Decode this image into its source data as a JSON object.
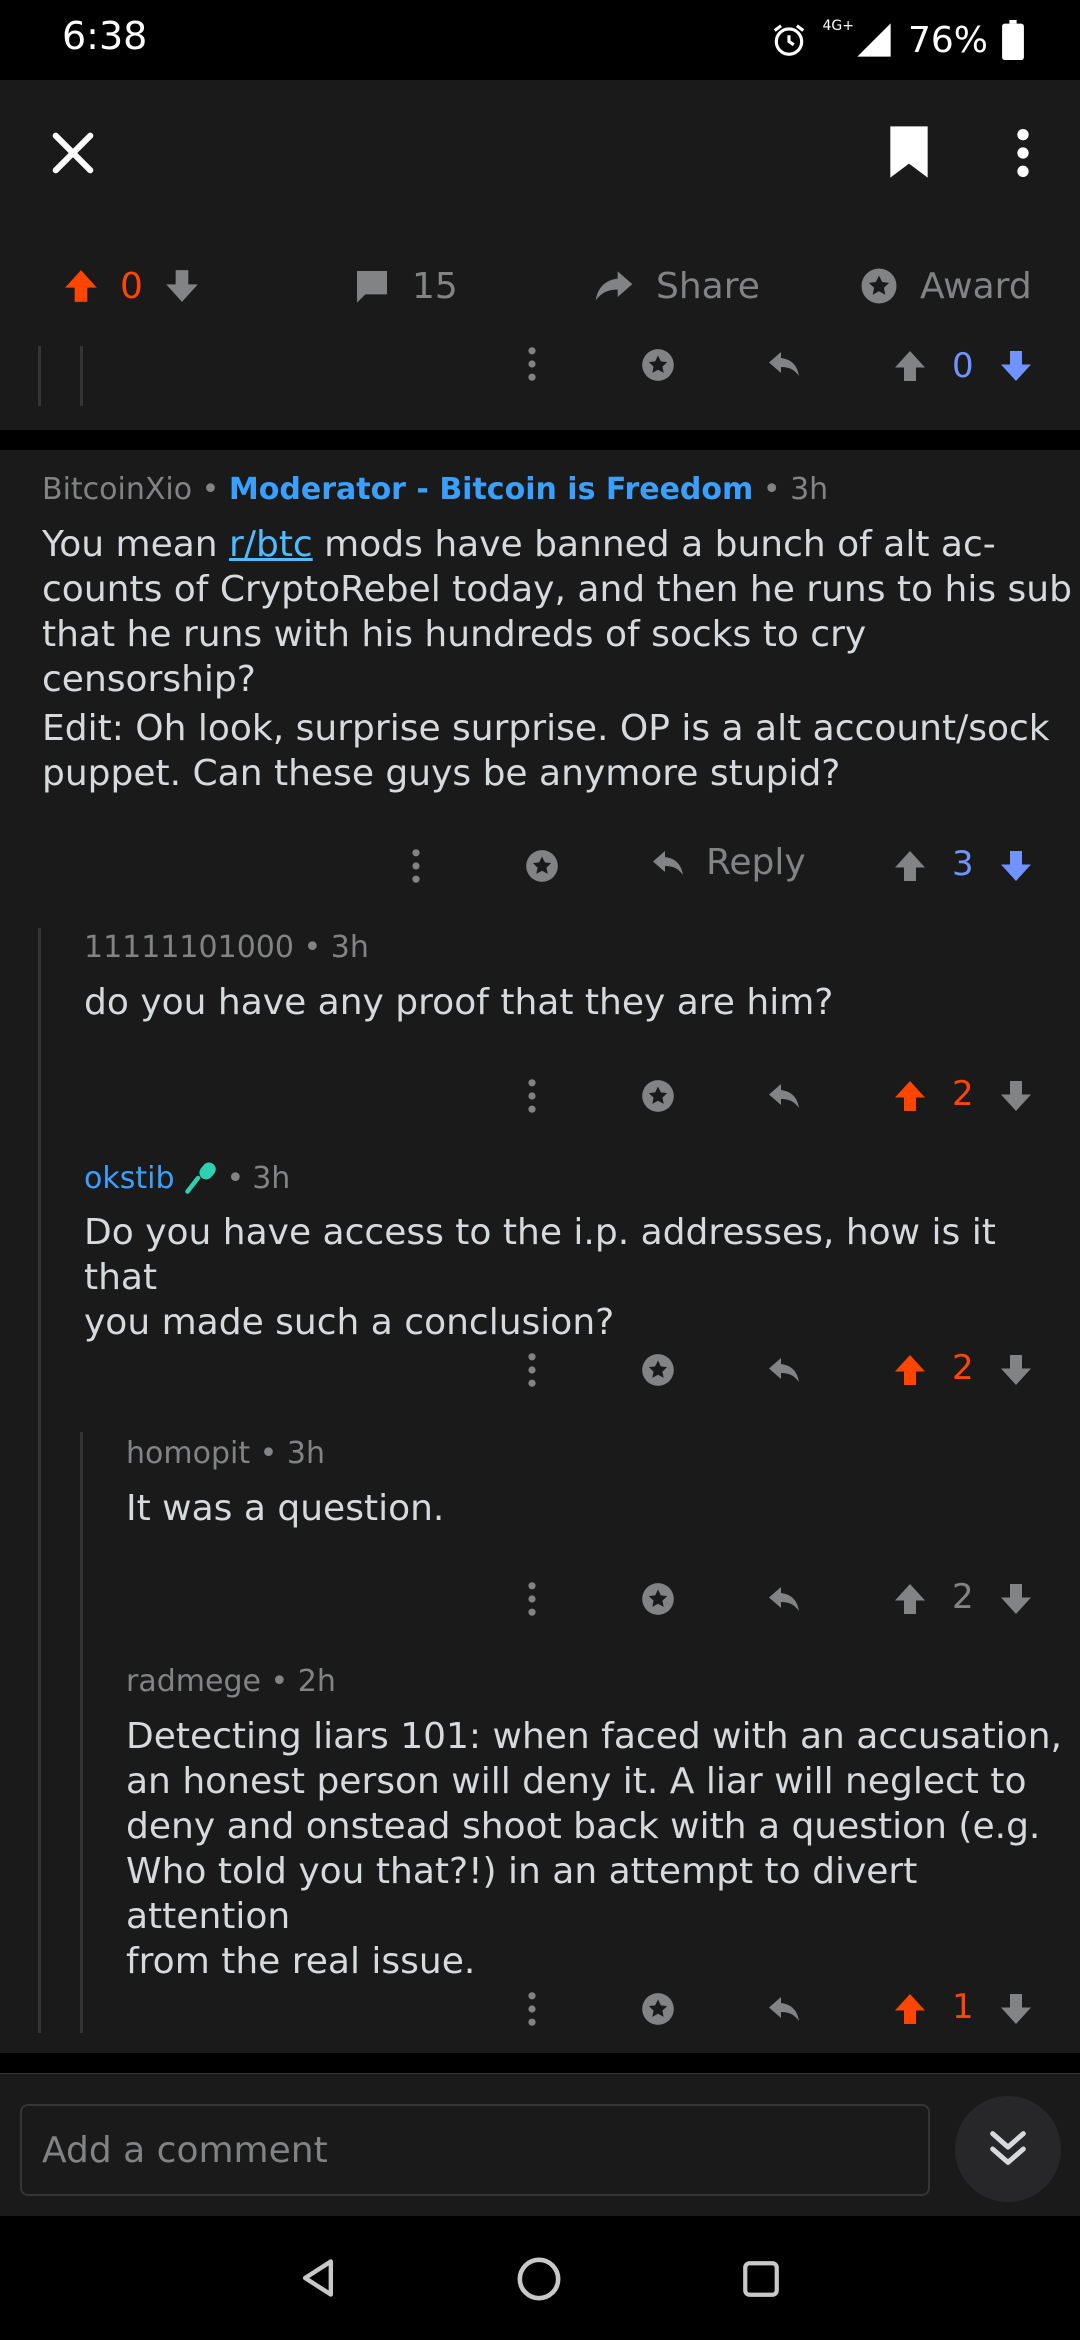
{
  "status": {
    "time": "6:38",
    "network": "4G+",
    "battery": "76%"
  },
  "actions": {
    "score": "0",
    "comments": "15",
    "share": "Share",
    "award": "Award"
  },
  "stub_comment": {
    "score": "0"
  },
  "comments": [
    {
      "author": "BitcoinXio",
      "flair": "Moderator - Bitcoin is Freedom",
      "time": "3h",
      "body_pre": "You mean ",
      "body_link": "r/btc",
      "body_post": " mods have banned a bunch of alt ac-\ncounts of CryptoRebel today, and then he runs to his sub\nthat he runs with his hundreds of socks to cry censorship?",
      "body2": "Edit: Oh look, surprise surprise. OP is a alt account/sock\npuppet. Can these guys be anymore stupid?",
      "reply": "Reply",
      "score": "3"
    },
    {
      "author": "11111101000",
      "time": "3h",
      "body": "do you have any proof that they are him?",
      "score": "2"
    },
    {
      "author": "okstib",
      "time": "3h",
      "body": "Do you have access to the i.p. addresses, how is it that\nyou made such a conclusion?",
      "score": "2"
    },
    {
      "author": "homopit",
      "time": "3h",
      "body": "It was a question.",
      "score": "2"
    },
    {
      "author": "radmege",
      "time": "2h",
      "body": "Detecting liars 101:  when faced with an accusation,\nan honest person will deny it.  A liar will neglect to\ndeny and onstead shoot back with a question (e.g.\nWho told you that?!) in an attempt to divert attention\nfrom the real issue.",
      "score": "1"
    }
  ],
  "composer": {
    "placeholder": "Add a comment"
  }
}
